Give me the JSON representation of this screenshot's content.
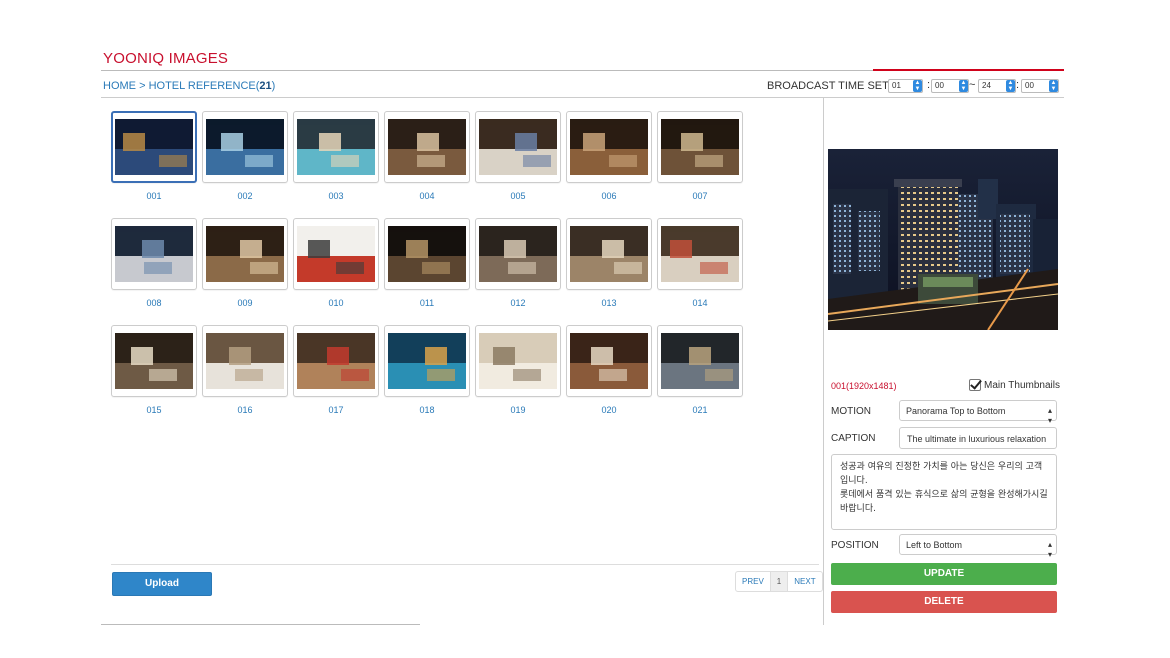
{
  "app": {
    "title": "YOONIQ IMAGES"
  },
  "breadcrumb": {
    "home": "HOME",
    "separator": ">",
    "section": "HOTEL REFERENCE",
    "count": "21"
  },
  "broadcast": {
    "label": "BROADCAST TIME SET:",
    "start_hour": "01",
    "start_min": "00",
    "range_sep": "~",
    "end_hour": "24",
    "end_min": "00"
  },
  "images": [
    {
      "label": "001",
      "palette": [
        "#0f1a33",
        "#2c4a7a",
        "#b78a45"
      ]
    },
    {
      "label": "002",
      "palette": [
        "#0c1a2c",
        "#3a6ea0",
        "#a9d0e4"
      ]
    },
    {
      "label": "003",
      "palette": [
        "#2a3b44",
        "#5fb6c8",
        "#e6d6b8"
      ]
    },
    {
      "label": "004",
      "palette": [
        "#2b1f17",
        "#7a5a3e",
        "#d9c2a0"
      ]
    },
    {
      "label": "005",
      "palette": [
        "#3a2b20",
        "#d9d2c6",
        "#6a7fa3"
      ]
    },
    {
      "label": "006",
      "palette": [
        "#2a1c12",
        "#8a5f3a",
        "#c9a37a"
      ]
    },
    {
      "label": "007",
      "palette": [
        "#22180f",
        "#6e5238",
        "#cfb88f"
      ]
    },
    {
      "label": "008",
      "palette": [
        "#1e2a3c",
        "#c7c9cf",
        "#6d8aab"
      ]
    },
    {
      "label": "009",
      "palette": [
        "#2d2015",
        "#8b6a48",
        "#e0c8a4"
      ]
    },
    {
      "label": "010",
      "palette": [
        "#f2f0ec",
        "#c43a2a",
        "#3c3c3c"
      ]
    },
    {
      "label": "011",
      "palette": [
        "#15110d",
        "#5b4530",
        "#b49466"
      ]
    },
    {
      "label": "012",
      "palette": [
        "#2b241e",
        "#7d6a58",
        "#d8c9b4"
      ]
    },
    {
      "label": "013",
      "palette": [
        "#3a2e24",
        "#9c8468",
        "#e5d6be"
      ]
    },
    {
      "label": "014",
      "palette": [
        "#4a3a2c",
        "#d9cfc0",
        "#c0503a"
      ]
    },
    {
      "label": "015",
      "palette": [
        "#2c2218",
        "#6e5a45",
        "#e8dcc6"
      ]
    },
    {
      "label": "016",
      "palette": [
        "#6a5642",
        "#e7e2da",
        "#b39d80"
      ]
    },
    {
      "label": "017",
      "palette": [
        "#4a3626",
        "#b0825a",
        "#c23a2e"
      ]
    },
    {
      "label": "018",
      "palette": [
        "#123f5a",
        "#2a8fb4",
        "#d9a24a"
      ]
    },
    {
      "label": "019",
      "palette": [
        "#d8ccb8",
        "#f1ebe0",
        "#8c7a62"
      ]
    },
    {
      "label": "020",
      "palette": [
        "#3a2418",
        "#8a5a3a",
        "#e7d9c4"
      ]
    },
    {
      "label": "021",
      "palette": [
        "#22262a",
        "#6b7580",
        "#b8a37e"
      ]
    }
  ],
  "footer": {
    "upload_label": "Upload",
    "pager": {
      "prev": "PREV",
      "current": "1",
      "next": "NEXT"
    }
  },
  "detail": {
    "info": "001(1920x1481)",
    "main_thumbnails_label": "Main Thumbnails",
    "main_thumbnails_checked": true,
    "motion_label": "MOTION",
    "motion_value": "Panorama Top to Bottom",
    "caption_label": "CAPTION",
    "caption_value": "The ultimate in luxurious relaxation",
    "description": "성공과 여유의 진정한 가치를 아는 당신은 우리의 고객입니다.\n롯데에서 품격 있는 휴식으로 삶의 균형을 완성해가시길 바랍니다.",
    "position_label": "POSITION",
    "position_value": "Left to Bottom",
    "update_label": "UPDATE",
    "delete_label": "DELETE"
  }
}
